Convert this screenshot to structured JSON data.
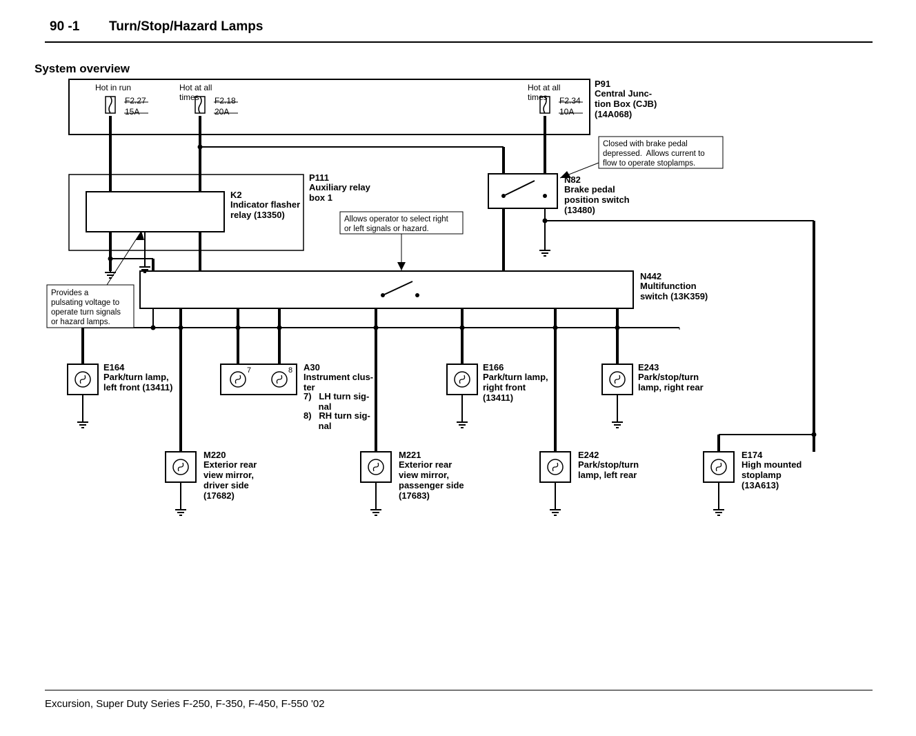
{
  "header": {
    "section": "90 -1",
    "title": "Turn/Stop/Hazard Lamps"
  },
  "subtitle": "System overview",
  "footer": "Excursion, Super Duty Series F-250, F-350, F-450, F-550 '02",
  "hot": {
    "run": "Hot in run",
    "all1": "Hot at all\ntimes",
    "all2": "Hot at all\ntimes"
  },
  "fuses": {
    "f227": {
      "num": "F2.27",
      "amp": "15A"
    },
    "f218": {
      "num": "F2.18",
      "amp": "20A"
    },
    "f234": {
      "num": "F2.34",
      "amp": "10A"
    }
  },
  "components": {
    "P91": {
      "id": "P91",
      "name": "Central Junc-\ntion Box (CJB)\n(14A068)"
    },
    "K2": {
      "id": "K2",
      "name": "Indicator flasher\nrelay (13350)"
    },
    "P111": {
      "id": "P111",
      "name": "Auxiliary relay\nbox 1"
    },
    "N82": {
      "id": "N82",
      "name": "Brake pedal\nposition switch\n(13480)"
    },
    "N442": {
      "id": "N442",
      "name": "Multifunction\nswitch (13K359)"
    },
    "E164": {
      "id": "E164",
      "name": "Park/turn lamp,\nleft front (13411)"
    },
    "A30": {
      "id": "A30",
      "name": "Instrument clus-\nter",
      "i7": "7",
      "i8": "8",
      "n7": "7)   LH turn sig-\n      nal",
      "n8": "8)   RH turn sig-\n      nal"
    },
    "E166": {
      "id": "E166",
      "name": "Park/turn lamp,\nright front\n(13411)"
    },
    "E243": {
      "id": "E243",
      "name": "Park/stop/turn\nlamp, right rear"
    },
    "M220": {
      "id": "M220",
      "name": "Exterior rear\nview mirror,\ndriver side\n(17682)"
    },
    "M221": {
      "id": "M221",
      "name": "Exterior rear\nview mirror,\npassenger side\n(17683)"
    },
    "E242": {
      "id": "E242",
      "name": "Park/stop/turn\nlamp, left rear"
    },
    "E174": {
      "id": "E174",
      "name": "High mounted\nstoplamp\n(13A613)"
    }
  },
  "callouts": {
    "flasher": "Provides a\npulsating voltage to\noperate turn signals\nor hazard lamps.",
    "multifunc": "Allows operator to select right\nor left signals or hazard.",
    "brake": "Closed with brake pedal\ndepressed.  Allows current to\nflow to operate stoplamps."
  }
}
